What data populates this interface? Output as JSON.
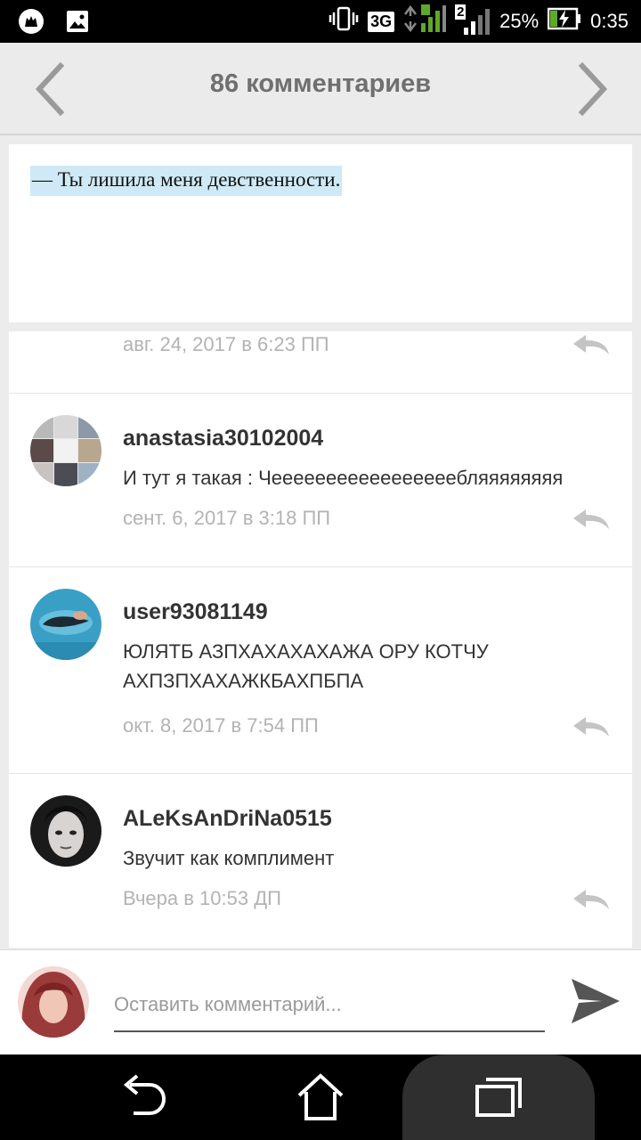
{
  "status_bar": {
    "network": "3G",
    "sim2": "2",
    "battery": "25%",
    "time": "0:35"
  },
  "header": {
    "title": "86 комментариев"
  },
  "post": {
    "text": "— Ты лишила меня девственности."
  },
  "comments": [
    {
      "user": "",
      "text": "",
      "date": "авг. 24, 2017 в 6:23 ПП"
    },
    {
      "user": "anastasia30102004",
      "text": "И тут я такая : Чееееееееееееееееебляяяяяяяя",
      "date": "сент. 6, 2017 в 3:18 ПП"
    },
    {
      "user": "user93081149",
      "text": "ЮЛЯТБ АЗПХАХАХАХАЖА ОРУ КОТЧУ АХПЗПХАХАЖКБАХПБПА",
      "date": "окт. 8, 2017 в 7:54 ПП"
    },
    {
      "user": "ALeKsAnDriNa0515",
      "text": "Звучит как комплимент",
      "date": "Вчера в 10:53 ДП"
    }
  ],
  "composer": {
    "placeholder": "Оставить комментарий..."
  },
  "colors": {
    "highlight": "#cfe9f6",
    "header_bg": "#ebebeb",
    "date_gray": "#b3b3b3"
  }
}
